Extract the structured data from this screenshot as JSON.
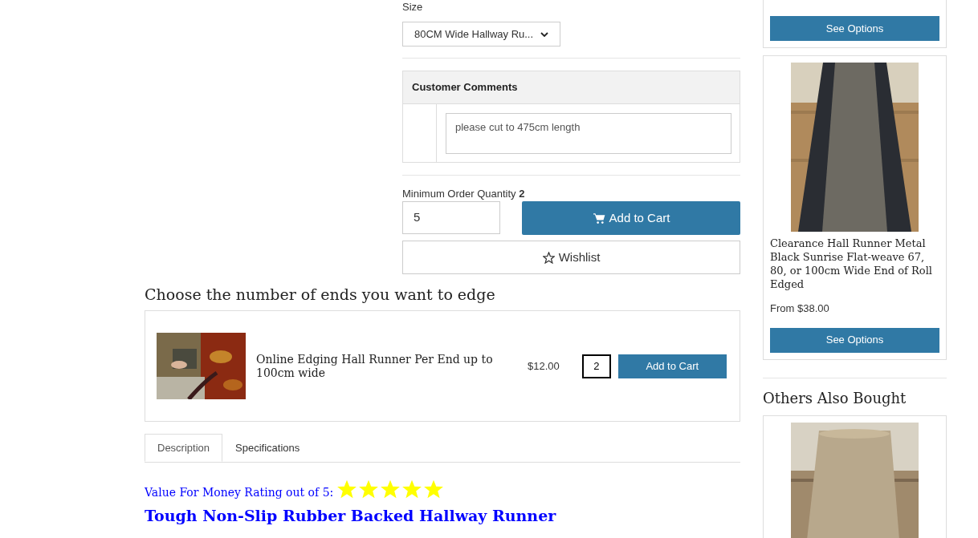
{
  "size_field": {
    "label": "Size",
    "value": "80CM Wide Hallway Ru..."
  },
  "comments": {
    "title": "Customer Comments",
    "value": "please cut to 475cm length"
  },
  "min_order": {
    "label": "Minimum Order Quantity",
    "value": "2"
  },
  "quantity": "5",
  "add_to_cart": "Add to Cart",
  "wishlist": "Wishlist",
  "edging": {
    "title": "Choose the number of ends you want to edge",
    "item": {
      "name": "Online Edging Hall Runner Per End up to 100cm wide",
      "price": "$12.00",
      "quantity": "2",
      "button": "Add to Cart"
    }
  },
  "tabs": [
    {
      "label": "Description",
      "selected": true
    },
    {
      "label": "Specifications",
      "selected": false
    }
  ],
  "rating": {
    "label": "Value For Money Rating out of 5:",
    "stars": 5
  },
  "heading": "Tough Non-Slip Rubber Backed Hallway Runner",
  "sidebar": {
    "top_card": {
      "button": "See Options"
    },
    "card": {
      "name": "Clearance Hall Runner Metal Black Sunrise Flat-weave 67, 80, or 100cm Wide End of Roll Edged",
      "price": "From $38.00",
      "button": "See Options"
    },
    "section_title": "Others Also Bought"
  }
}
